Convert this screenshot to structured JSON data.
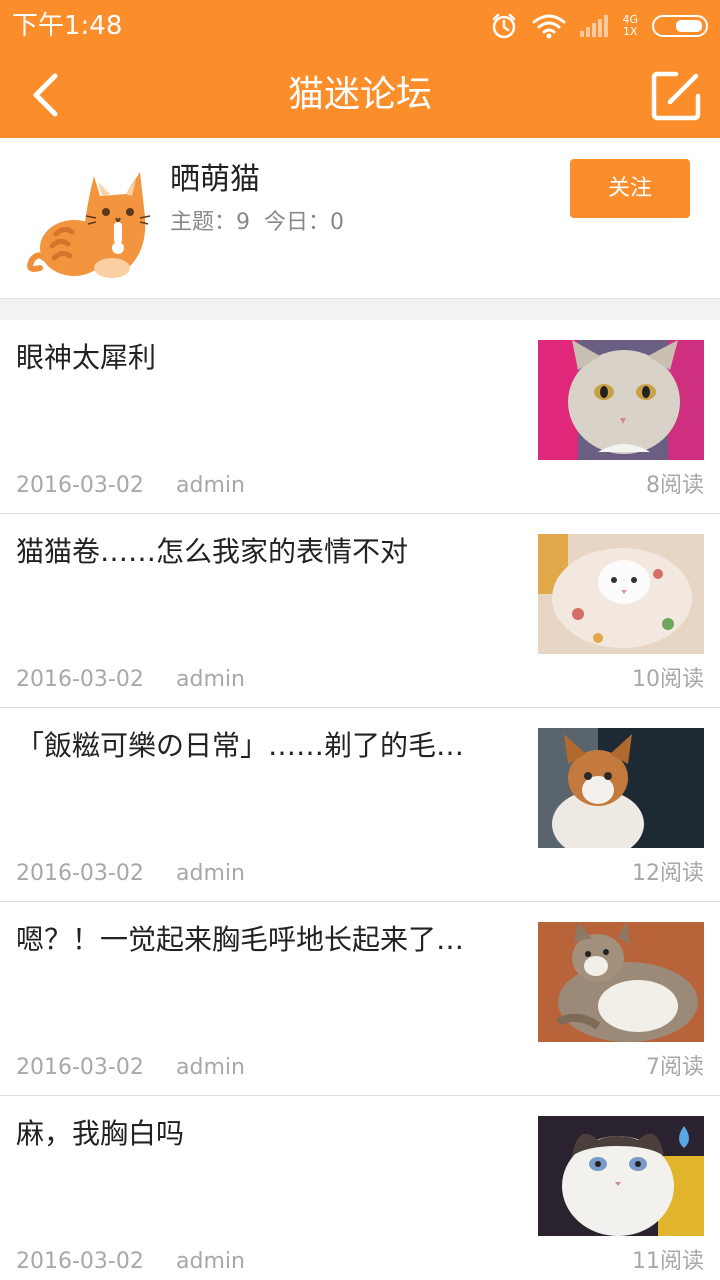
{
  "status_bar": {
    "time": "下午1:48",
    "network_top": "4G",
    "network_bottom": "1X"
  },
  "nav": {
    "title": "猫迷论坛",
    "back_icon": "chevron-left-icon",
    "compose_icon": "compose-icon"
  },
  "forum": {
    "name": "晒萌猫",
    "topics": "主题：9",
    "today": "今日：0",
    "follow_label": "关注"
  },
  "posts": [
    {
      "title": "眼神太犀利",
      "date": "2016-03-02",
      "author": "admin",
      "reads": "8阅读"
    },
    {
      "title": "猫猫卷……怎么我家的表情不对",
      "date": "2016-03-02",
      "author": "admin",
      "reads": "10阅读"
    },
    {
      "title": "「飯糍可樂の日常」……剃了的毛…",
      "date": "2016-03-02",
      "author": "admin",
      "reads": "12阅读"
    },
    {
      "title": "嗯？！一觉起来胸毛呼地长起来了…",
      "date": "2016-03-02",
      "author": "admin",
      "reads": "7阅读"
    },
    {
      "title": "麻，我胸白吗",
      "date": "2016-03-02",
      "author": "admin",
      "reads": "11阅读"
    }
  ],
  "colors": {
    "accent": "#fb8d2a",
    "meta_text": "#a8a8a8"
  }
}
